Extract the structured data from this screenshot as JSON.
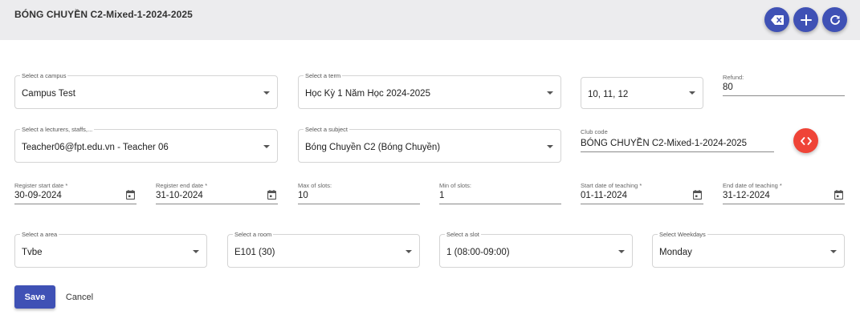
{
  "header": {
    "title": "BÓNG CHUYỀN C2-Mixed-1-2024-2025"
  },
  "toolbar": {
    "clear_icon": "backspace-icon",
    "add_icon": "plus-icon",
    "refresh_icon": "refresh-icon"
  },
  "form": {
    "campus": {
      "label": "Select a campus",
      "value": "Campus Test"
    },
    "term": {
      "label": "Select a term",
      "value": "Học Kỳ 1 Năm Học 2024-2025"
    },
    "grades": {
      "label": "",
      "value": "10, 11, 12"
    },
    "refund": {
      "label": "Refund:",
      "value": "80"
    },
    "lecturer": {
      "label": "Select a lecturers, staffs,...",
      "value": "Teacher06@fpt.edu.vn - Teacher 06"
    },
    "subject": {
      "label": "Select a subject",
      "value": "Bóng Chuyền C2 (Bóng Chuyền)"
    },
    "club_code": {
      "label": "Club code",
      "value": "BÓNG CHUYỀN C2-Mixed-1-2024-2025"
    },
    "register_start": {
      "label": "Register start date *",
      "value": "30-09-2024"
    },
    "register_end": {
      "label": "Register end date *",
      "value": "31-10-2024"
    },
    "max_slots": {
      "label": "Max of slots:",
      "value": "10"
    },
    "min_slots": {
      "label": "Min of slots:",
      "value": "1"
    },
    "teach_start": {
      "label": "Start date of teaching *",
      "value": "01-11-2024"
    },
    "teach_end": {
      "label": "End date of teaching *",
      "value": "31-12-2024"
    },
    "area": {
      "label": "Select a area",
      "value": "Tvbe"
    },
    "room": {
      "label": "Select a room",
      "value": "E101 (30)"
    },
    "slot": {
      "label": "Select a slot",
      "value": "1 (08:00-09:00)"
    },
    "weekdays": {
      "label": "Select Weekdays",
      "value": "Monday"
    }
  },
  "actions": {
    "save_label": "Save",
    "cancel_label": "Cancel"
  },
  "colors": {
    "primary": "#3f51b5",
    "danger": "#ef4437",
    "header_bg": "#ececee"
  }
}
